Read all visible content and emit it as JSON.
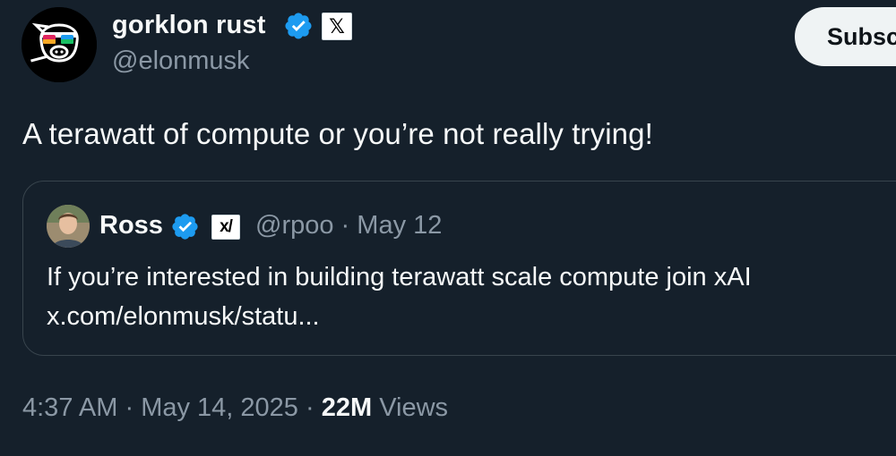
{
  "author": {
    "display_name": "gorklon rust",
    "handle": "@elonmusk",
    "verified_icon": "verified-badge-icon",
    "affiliation_icon": "x-logo-icon",
    "affiliation_glyph": "𝕏"
  },
  "actions": {
    "subscribe_label": "Subscribe"
  },
  "tweet": {
    "text": "A terawatt of compute or you’re not really trying!"
  },
  "quote": {
    "display_name": "Ross",
    "handle": "@rpoo",
    "separator": "·",
    "date": "May 12",
    "verified_icon": "verified-badge-icon",
    "affiliation_icon": "xai-logo-icon",
    "affiliation_glyph": "x/",
    "text_line1": "If you’re interested in building terawatt scale compute join xAI",
    "text_line2": "x.com/elonmusk/statu..."
  },
  "footer": {
    "time": "4:37 AM",
    "separator": "·",
    "date": "May 14, 2025",
    "views_count": "22M",
    "views_label": "Views"
  },
  "colors": {
    "background": "#15202b",
    "verified_blue": "#1d9bf0",
    "text_primary": "#f7f9f9",
    "text_secondary": "#8b98a5",
    "border": "#38444d",
    "button_bg": "#eff3f4"
  }
}
